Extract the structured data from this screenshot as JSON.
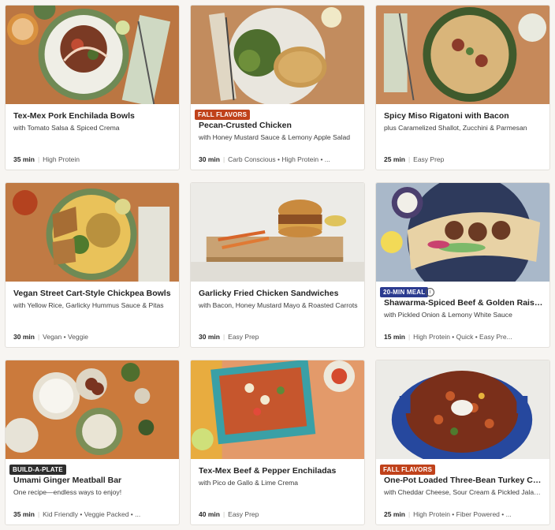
{
  "cards": [
    {
      "title": "Tex-Mex Pork Enchilada Bowls",
      "subtitle": "with Tomato Salsa & Spiced Crema",
      "time": "35 min",
      "tags": "High Protein",
      "badge": ""
    },
    {
      "title": "Pecan-Crusted Chicken",
      "subtitle": "with Honey Mustard Sauce & Lemony Apple Salad",
      "time": "30 min",
      "tags": "Carb Conscious • High Protein • ...",
      "badge": "FALL FLAVORS"
    },
    {
      "title": "Spicy Miso Rigatoni with Bacon",
      "subtitle": "plus Caramelized Shallot, Zucchini & Parmesan",
      "time": "25 min",
      "tags": "Easy Prep",
      "badge": ""
    },
    {
      "title": "Vegan Street Cart-Style Chickpea Bowls",
      "subtitle": "with Yellow Rice, Garlicky Hummus Sauce & Pitas",
      "time": "30 min",
      "tags": "Vegan • Veggie",
      "badge": ""
    },
    {
      "title": "Garlicky Fried Chicken Sandwiches",
      "subtitle": "with Bacon, Honey Mustard Mayo & Roasted Carrots",
      "time": "30 min",
      "tags": "Easy Prep",
      "badge": ""
    },
    {
      "title": "Shawarma-Spiced Beef & Golden Raisin Pit...",
      "subtitle": "with Pickled Onion & Lemony White Sauce",
      "time": "15 min",
      "tags": "High Protein • Quick • Easy Pre...",
      "badge": "20-MIN MEAL",
      "info": "i"
    },
    {
      "title": "Umami Ginger Meatball Bar",
      "subtitle": "One recipe—endless ways to enjoy!",
      "time": "35 min",
      "tags": "Kid Friendly • Veggie Packed • ...",
      "badge": "BUILD-A-PLATE"
    },
    {
      "title": "Tex-Mex Beef & Pepper Enchiladas",
      "subtitle": "with Pico de Gallo & Lime Crema",
      "time": "40 min",
      "tags": "Easy Prep",
      "badge": ""
    },
    {
      "title": "One-Pot Loaded Three-Bean Turkey Chili",
      "subtitle": "with Cheddar Cheese, Sour Cream & Pickled Jalape...",
      "time": "25 min",
      "tags": "High Protein • Fiber Powered • ...",
      "badge": "FALL FLAVORS"
    }
  ]
}
